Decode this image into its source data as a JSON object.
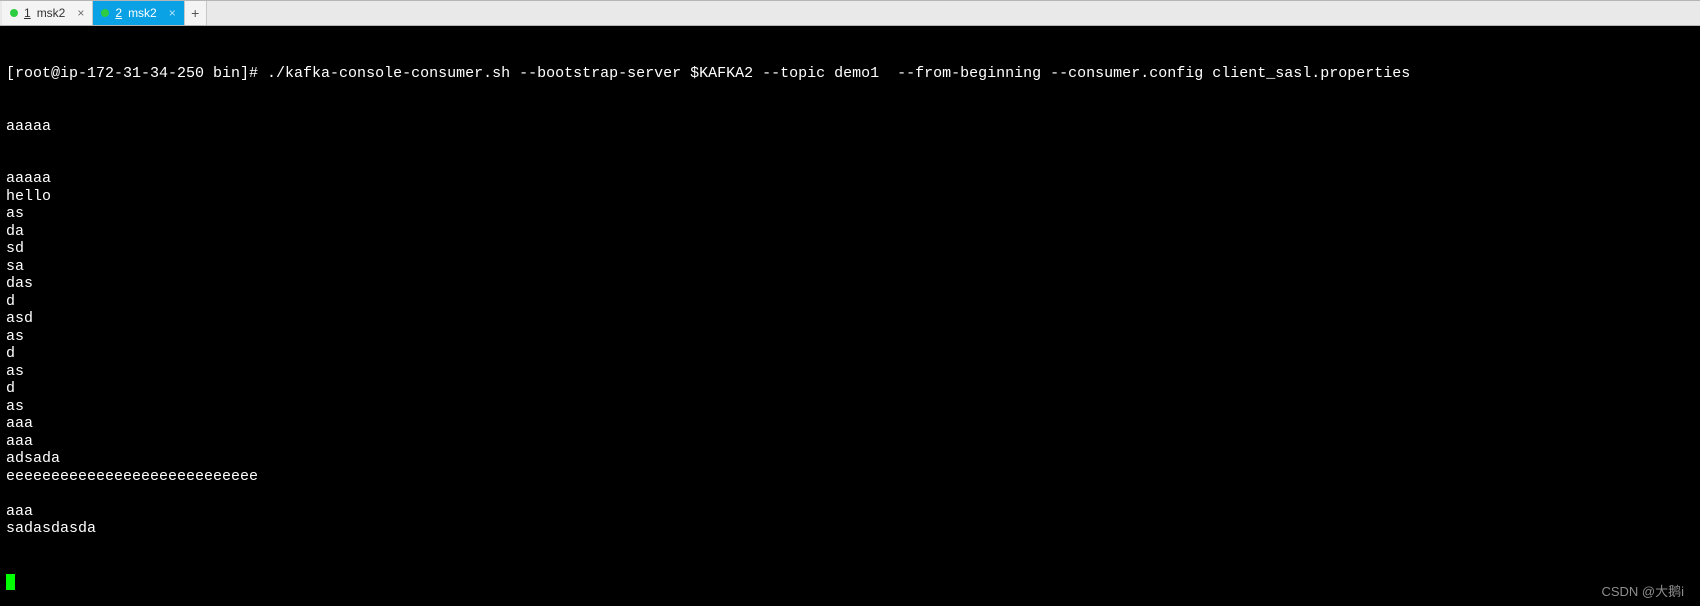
{
  "tabs": [
    {
      "index": "1",
      "label": "msk2",
      "dot_color": "#2ecc40",
      "active": false
    },
    {
      "index": "2",
      "label": "msk2",
      "dot_color": "#2ecc40",
      "active": true
    }
  ],
  "add_tab_label": "+",
  "terminal": {
    "prompt": "[root@ip-172-31-34-250 bin]# ",
    "command": "./kafka-console-consumer.sh --bootstrap-server $KAFKA2 --topic demo1  --from-beginning --consumer.config client_sasl.properties",
    "output_lines": [
      "aaaaa",
      "",
      "",
      "aaaaa",
      "hello",
      "as",
      "da",
      "sd",
      "sa",
      "das",
      "d",
      "asd",
      "as",
      "d",
      "as",
      "d",
      "as",
      "aaa",
      "aaa",
      "adsada",
      "eeeeeeeeeeeeeeeeeeeeeeeeeeee",
      "",
      "aaa",
      "sadasdasda"
    ]
  },
  "watermark": "CSDN @大鹅i"
}
